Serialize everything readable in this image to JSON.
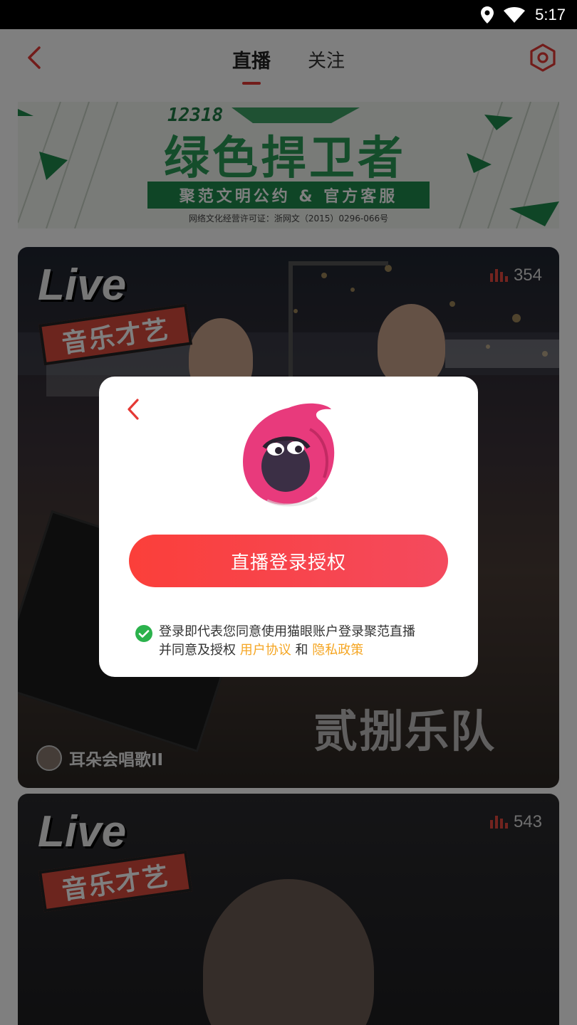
{
  "status_bar": {
    "time": "5:17"
  },
  "header": {
    "tabs": [
      {
        "label": "直播",
        "active": true
      },
      {
        "label": "关注",
        "active": false
      }
    ]
  },
  "banner": {
    "number": "12318",
    "title": "绿色捍卫者",
    "subtitle": "聚范文明公约 & 官方客服",
    "license": "网络文化经营许可证：浙网文（2015）0296-066号"
  },
  "cards": [
    {
      "viewers": "354",
      "live_logo_top": "Live",
      "live_logo_bottom": "音乐才艺",
      "band_name": "贰捌乐队",
      "anchor_name": "耳朵会唱歌II"
    },
    {
      "viewers": "543",
      "live_logo_top": "Live",
      "live_logo_bottom": "音乐才艺"
    }
  ],
  "modal": {
    "button_label": "直播登录授权",
    "agreement": {
      "line1": "登录即代表您同意使用猫眼账户登录聚范直播",
      "line2_prefix": "并同意及授权",
      "link_user": "用户协议",
      "conjunction": "和",
      "link_privacy": "隐私政策"
    }
  },
  "colors": {
    "accent": "#e53935",
    "button_gradient_start": "#fb3f3a",
    "button_gradient_end": "#f44a5e",
    "link": "#f5a623",
    "check": "#2bb24c",
    "banner_green": "#2a9a57",
    "mascot": "#e83a7c"
  },
  "icons": {
    "status": [
      "location-icon",
      "wifi-icon"
    ],
    "header_left": "back-chevron-icon",
    "header_right": "settings-hexagon-icon",
    "modal_back": "back-chevron-icon",
    "viewer": "signal-bars-icon",
    "agree": "check-circle-icon"
  }
}
